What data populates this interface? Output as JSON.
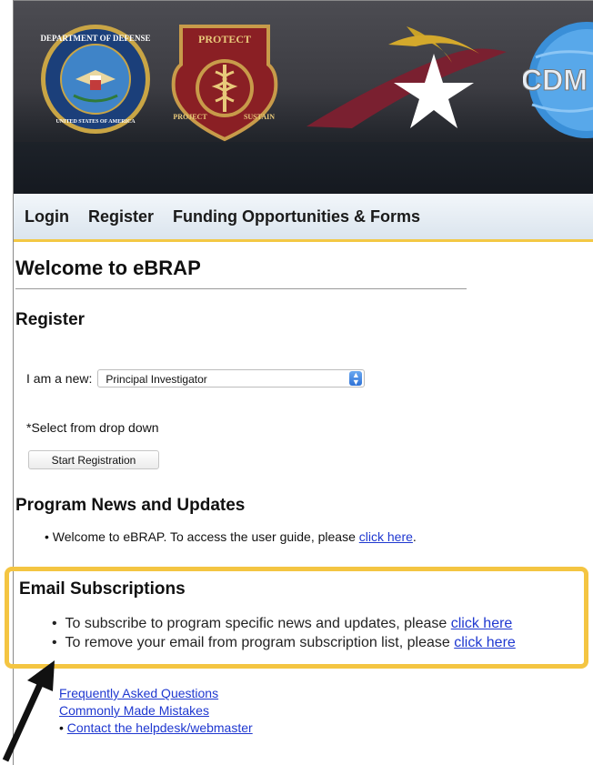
{
  "banner": {
    "logos": [
      "department-of-defense-seal",
      "protect-project-sustain-seal",
      "star-eagle-logo",
      "cdmrp-logo"
    ],
    "seal_texts": {
      "dod_ring": "DEPARTMENT OF DEFENSE",
      "dod_bottom": "UNITED STATES OF AMERICA",
      "protect_top": "PROTECT",
      "protect_left": "PROJECT",
      "protect_right": "SUSTAIN",
      "cdm": "CDM"
    },
    "colors": {
      "header_dark": "#14161b",
      "gold": "#d4a017",
      "maroon": "#7a2030",
      "blue": "#2f80d0"
    }
  },
  "nav": {
    "items": [
      "Login",
      "Register",
      "Funding Opportunities & Forms"
    ]
  },
  "main": {
    "welcome_title": "Welcome to eBRAP",
    "register": {
      "heading": "Register",
      "label": "I am a new:",
      "selected": "Principal Investigator",
      "hint": "*Select from drop down",
      "button": "Start Registration"
    },
    "news": {
      "heading": "Program News and Updates",
      "item_text": "Welcome to eBRAP. To access the user guide, please ",
      "item_link": "click here",
      "item_after": "."
    },
    "email": {
      "heading": "Email Subscriptions",
      "items": [
        {
          "text": "To subscribe to program specific news and updates, please ",
          "link": "click here"
        },
        {
          "text": "To remove your email from program subscription list, please ",
          "link": "click here"
        }
      ]
    },
    "footer_links": [
      "Frequently Asked Questions",
      "Commonly Made Mistakes",
      "Contact the helpdesk/webmaster"
    ]
  },
  "accent": {
    "highlight": "#f4c542",
    "link": "#1f38d0",
    "nav_underline": "#f3c844"
  }
}
